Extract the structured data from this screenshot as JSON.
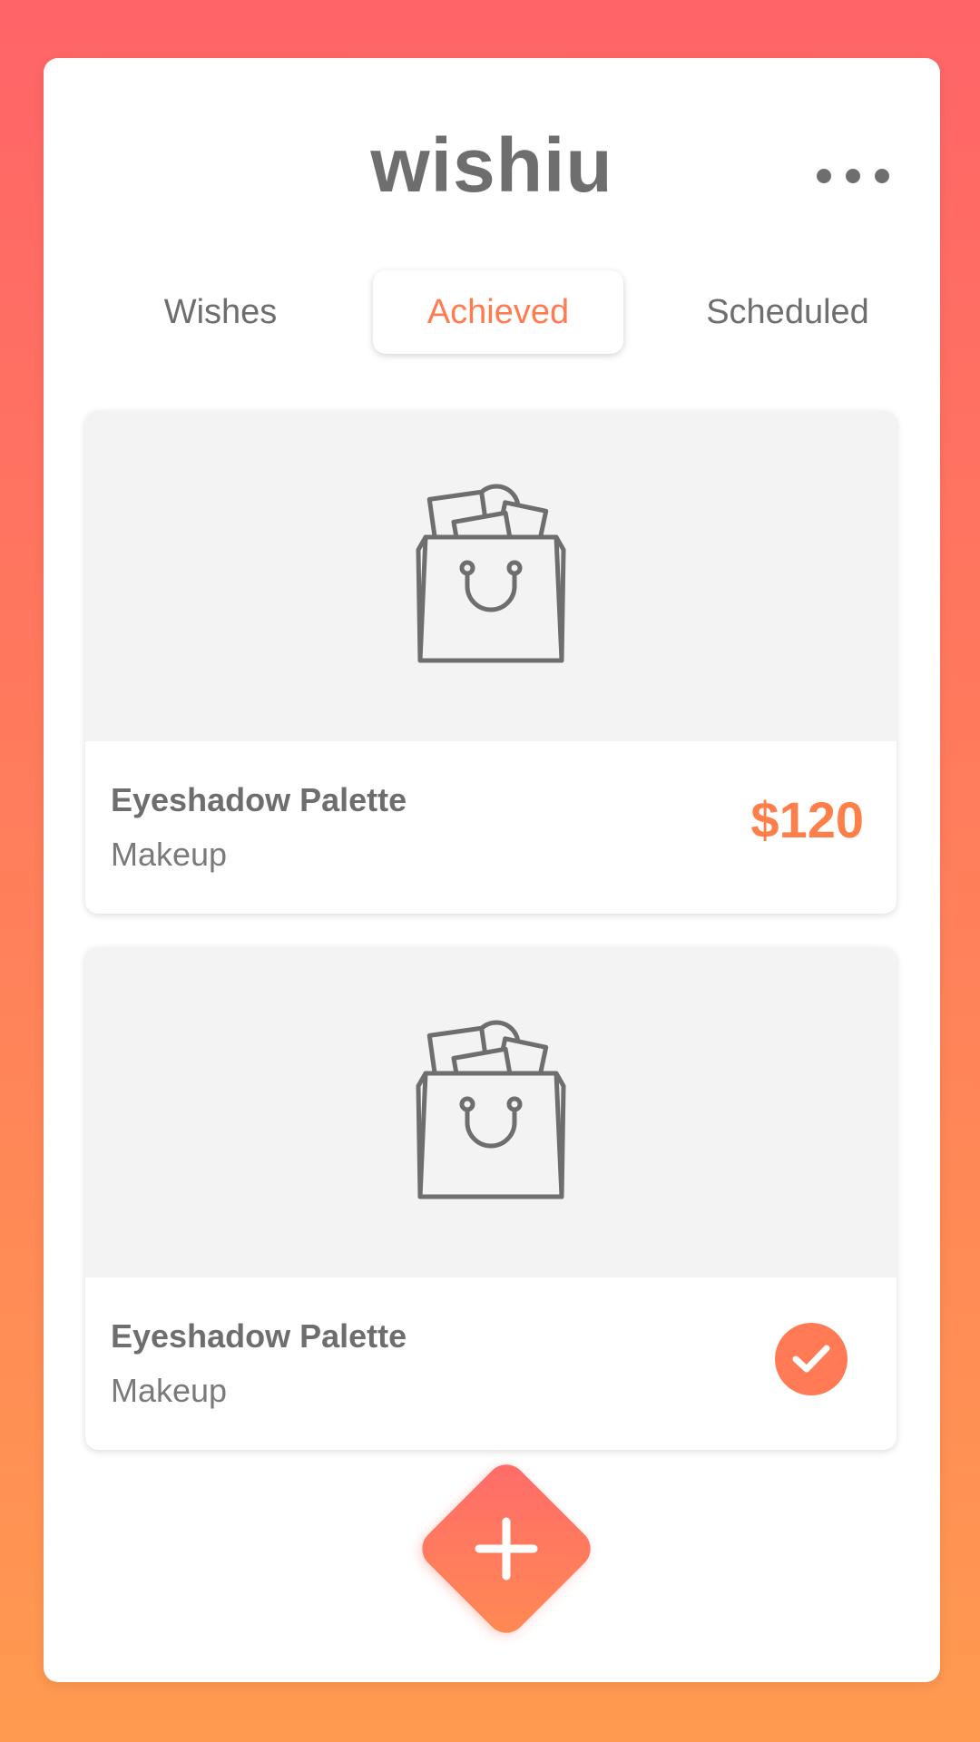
{
  "app": {
    "logo_text": "wishiu",
    "menu_icon": "more-horizontal-icon"
  },
  "tabs": [
    {
      "label": "Wishes",
      "selected": false
    },
    {
      "label": "Achieved",
      "selected": true
    },
    {
      "label": "Scheduled",
      "selected": false
    }
  ],
  "cards": [
    {
      "title": "Eyeshadow Palette",
      "category": "Makeup",
      "price": "$120",
      "image_icon": "shopping-bag-icon"
    },
    {
      "title": "Eyeshadow Palette",
      "category": "Makeup",
      "status_icon": "check-icon",
      "image_icon": "shopping-bag-icon"
    }
  ],
  "fab": {
    "icon": "plus-icon"
  },
  "colors": {
    "accent": "#ff7b50",
    "gradient_top": "#ff6468",
    "gradient_bottom": "#ff9a50",
    "text": "#6e6e6e",
    "card_media_bg": "#f3f3f3"
  }
}
